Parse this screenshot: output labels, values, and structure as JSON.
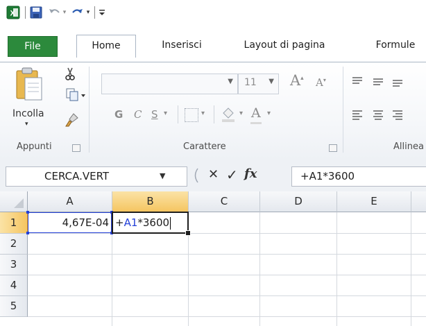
{
  "quick_access": {
    "app_icon": "excel-logo-icon",
    "save_icon": "save-icon",
    "undo_icon": "undo-icon",
    "redo_icon": "redo-icon",
    "customize_icon": "customize-qat-icon"
  },
  "tabs": [
    {
      "label": "File"
    },
    {
      "label": "Home"
    },
    {
      "label": "Inserisci"
    },
    {
      "label": "Layout di pagina"
    },
    {
      "label": "Formule"
    }
  ],
  "ribbon": {
    "clipboard": {
      "paste_label": "Incolla",
      "group_label": "Appunti"
    },
    "font": {
      "font_name": "",
      "font_size": "11",
      "grow_glyph": "A",
      "shrink_glyph": "A",
      "bold_glyph": "G",
      "italic_glyph": "C",
      "underline_glyph": "S",
      "font_color_glyph": "A",
      "group_label": "Carattere"
    },
    "alignment": {
      "group_label": "Allinea"
    }
  },
  "formula_bar": {
    "name_box": "CERCA.VERT",
    "cancel_glyph": "✕",
    "enter_glyph": "✓",
    "fx_glyph": "fx",
    "content": "+A1*3600"
  },
  "grid": {
    "columns": [
      "A",
      "B",
      "C",
      "D",
      "E"
    ],
    "rows": [
      "1",
      "2",
      "3",
      "4",
      "5"
    ],
    "cells": {
      "A1": "4,67E-04",
      "B1_prefix": "+",
      "B1_ref": "A1",
      "B1_suffix": "*3600"
    },
    "active_cell": "B1",
    "colors": {
      "ref_blue": "#2340d8",
      "select_orange": "#f5c561",
      "excel_green": "#2c8a3c"
    }
  }
}
